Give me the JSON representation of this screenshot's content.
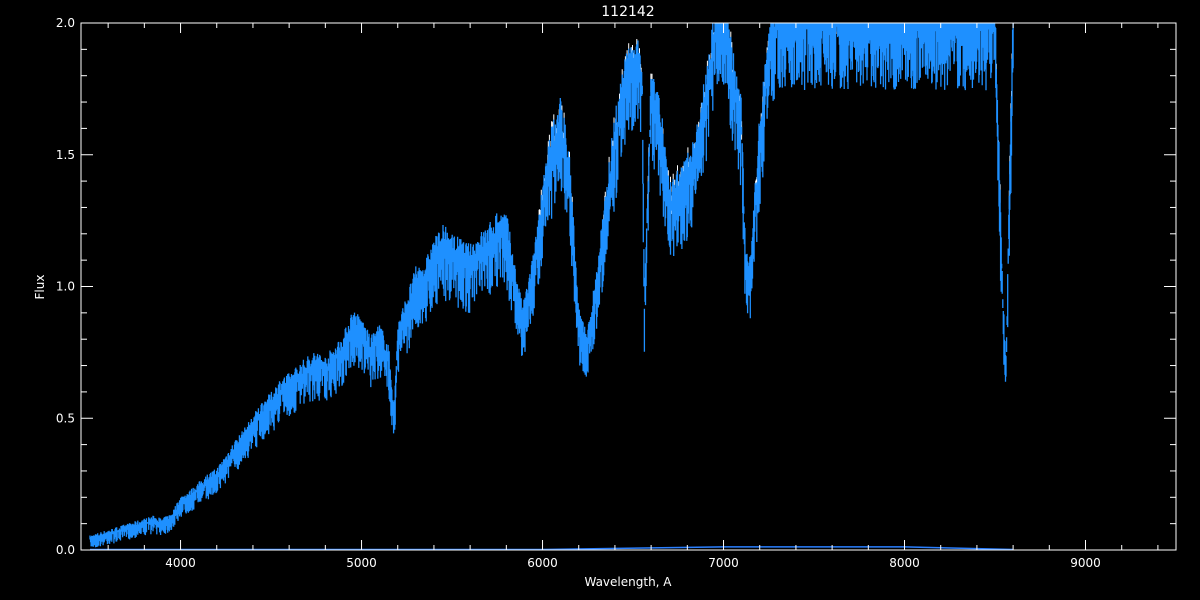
{
  "chart_data": {
    "type": "line",
    "title": "112142",
    "xlabel": "Wavelength, A",
    "ylabel": "Flux",
    "xlim": [
      3450,
      9500
    ],
    "ylim": [
      0.0,
      2.0
    ],
    "x_ticks": [
      4000,
      5000,
      6000,
      7000,
      8000,
      9000
    ],
    "x_tick_labels": [
      "4000",
      "5000",
      "6000",
      "7000",
      "8000",
      "9000"
    ],
    "y_ticks": [
      0.0,
      0.5,
      1.0,
      1.5,
      2.0
    ],
    "y_tick_labels": [
      "0.0",
      "0.5",
      "1.0",
      "1.5",
      "2.0"
    ],
    "grid": false,
    "colors": {
      "background": "#000000",
      "axes": "#ffffff",
      "spectrum": "#1e90ff",
      "spectrum_highlight": "#ffffff",
      "error": "#2a7fff"
    },
    "series": [
      {
        "x": [
          3500,
          3550,
          3600,
          3650,
          3700,
          3750,
          3800,
          3850,
          3900,
          3950,
          4000,
          4050,
          4100,
          4150,
          4200,
          4250,
          4300,
          4350,
          4400,
          4450,
          4500,
          4550,
          4600,
          4650,
          4700,
          4750,
          4800,
          4850,
          4900,
          4950,
          5000,
          5050,
          5100,
          5150,
          5180,
          5200,
          5250,
          5300,
          5350,
          5400,
          5450,
          5500,
          5550,
          5600,
          5650,
          5700,
          5750,
          5800,
          5850,
          5890,
          5950,
          6000,
          6050,
          6100,
          6150,
          6200,
          6250,
          6300,
          6350,
          6400,
          6450,
          6500,
          6550,
          6563,
          6600,
          6650,
          6700,
          6750,
          6800,
          6850,
          6900,
          6950,
          7000,
          7050,
          7100,
          7120,
          7150,
          7200,
          7250,
          7300,
          7500,
          7700,
          7900,
          8100,
          8300,
          8400,
          8500,
          8540,
          8560,
          8600
        ],
        "y": [
          0.04,
          0.05,
          0.06,
          0.07,
          0.08,
          0.09,
          0.1,
          0.11,
          0.1,
          0.12,
          0.18,
          0.2,
          0.23,
          0.26,
          0.28,
          0.33,
          0.38,
          0.42,
          0.47,
          0.52,
          0.55,
          0.6,
          0.62,
          0.65,
          0.68,
          0.7,
          0.68,
          0.72,
          0.76,
          0.85,
          0.82,
          0.75,
          0.8,
          0.72,
          0.5,
          0.8,
          0.9,
          1.0,
          1.02,
          1.1,
          1.15,
          1.12,
          1.1,
          1.08,
          1.12,
          1.15,
          1.2,
          1.2,
          1.0,
          0.86,
          1.05,
          1.3,
          1.5,
          1.62,
          1.4,
          0.85,
          0.78,
          1.0,
          1.3,
          1.55,
          1.75,
          1.85,
          1.8,
          0.9,
          1.75,
          1.6,
          1.3,
          1.35,
          1.4,
          1.5,
          1.7,
          1.95,
          2.0,
          1.8,
          1.6,
          1.1,
          1.05,
          1.55,
          1.9,
          2.0,
          2.0,
          2.0,
          2.0,
          2.0,
          2.0,
          2.0,
          2.0,
          1.0,
          0.65,
          2.0
        ]
      },
      {
        "x": [
          3500,
          4000,
          5000,
          6000,
          7000,
          7600,
          8000,
          8600
        ],
        "y": [
          0.0,
          0.0,
          0.0,
          0.0,
          0.01,
          0.01,
          0.01,
          0.0
        ]
      }
    ]
  }
}
